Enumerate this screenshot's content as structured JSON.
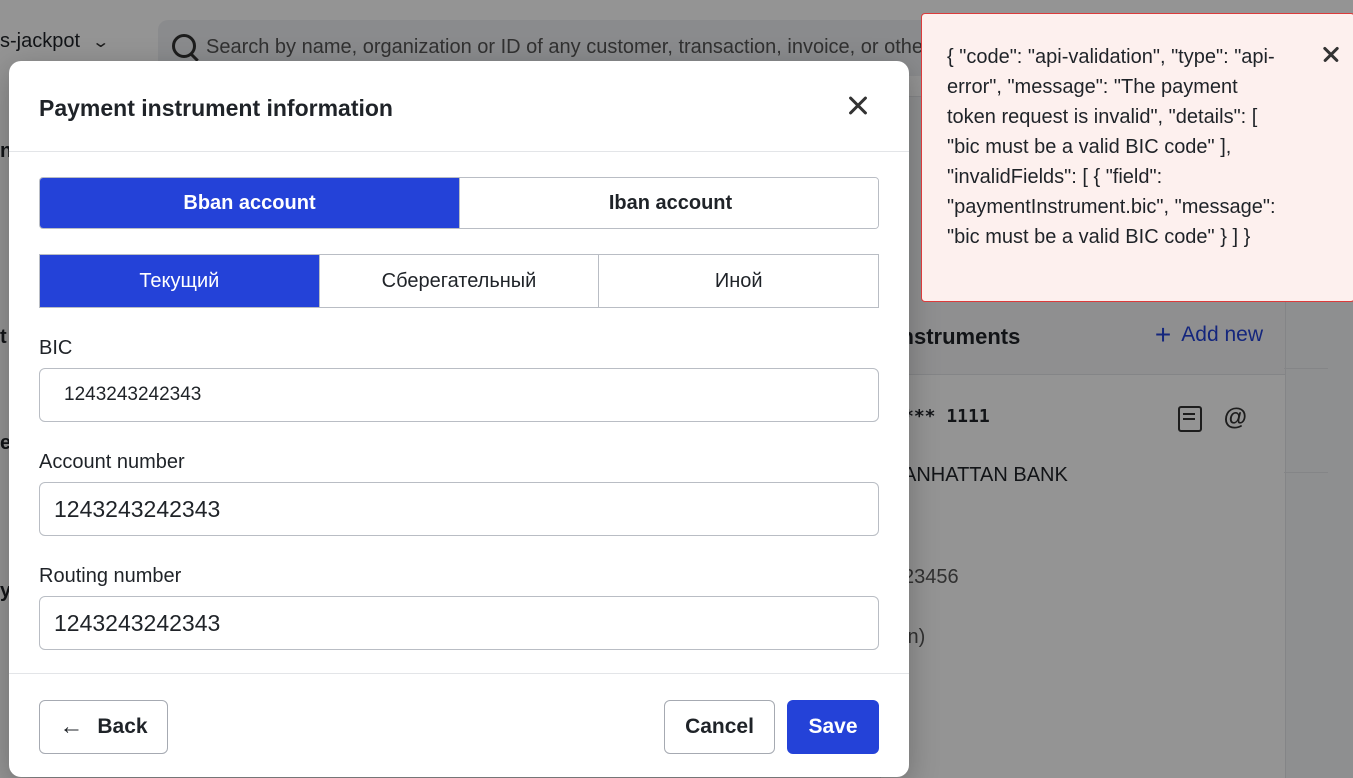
{
  "background": {
    "workspace_name": "s-jackpot",
    "search_placeholder": "Search by name, organization or ID of any customer, transaction, invoice, or other",
    "instruments_title": "t instruments",
    "add_new_label": "Add new",
    "masked_number": "*** 1111",
    "bank_name": "ANHATTAN BANK",
    "routing_fragment": "23456",
    "misc_fragment": "in)",
    "left_fragments": [
      "n",
      "t",
      "e",
      "y"
    ]
  },
  "modal": {
    "title": "Payment instrument information",
    "account_types": [
      "Bban account",
      "Iban account"
    ],
    "selected_account_type": "Bban account",
    "subtypes": [
      "Текущий",
      "Сберегательный",
      "Иной"
    ],
    "selected_subtype": "Текущий",
    "fields": {
      "bic": {
        "label": "BIC",
        "value": "1243243242343"
      },
      "account_number": {
        "label": "Account number",
        "value": "1243243242343"
      },
      "routing_number": {
        "label": "Routing number",
        "value": "1243243242343"
      }
    },
    "buttons": {
      "back": "Back",
      "cancel": "Cancel",
      "save": "Save"
    }
  },
  "toast": {
    "message": "{ \"code\": \"api-validation\", \"type\": \"api-error\", \"message\": \"The payment token request is invalid\", \"details\": [ \"bic must be a valid BIC code\" ], \"invalidFields\": [ { \"field\": \"paymentInstrument.bic\", \"message\": \"bic must be a valid BIC code\" } ] }",
    "type": "error"
  },
  "colors": {
    "primary": "#2442d8",
    "error_border": "#dc3b3b",
    "error_bg": "#fdf0ee"
  }
}
